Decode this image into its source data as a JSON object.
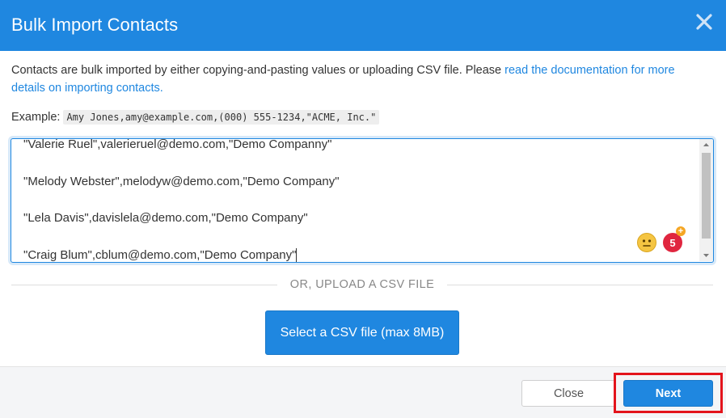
{
  "dialog": {
    "title": "Bulk Import Contacts",
    "close_icon": "close-icon"
  },
  "intro": {
    "text": "Contacts are bulk imported by either copying-and-pasting values or uploading CSV file. Please ",
    "link_text": "read the documentation for more details on importing contacts.",
    "link_color": "#1f87e0"
  },
  "example": {
    "label": "Example:",
    "code": "Amy Jones,amy@example.com,(000) 555-1234,\"ACME, Inc.\""
  },
  "textarea": {
    "lines": [
      "\"Valerie Ruel\",valerieruel@demo.com,\"Demo Companny\"",
      "\"Melody Webster\",melodyw@demo.com,\"Demo Company\"",
      "\"Lela Davis\",davislela@demo.com,\"Demo Company\"",
      "\"Craig Blum\",cblum@demo.com,\"Demo Company\""
    ],
    "emoji_icon": "neutral-face-icon",
    "grammar_badge_count": "5",
    "grammar_badge_plus": "+"
  },
  "upload": {
    "divider_label": "OR, UPLOAD A CSV FILE",
    "button_label": "Select a CSV file (max 8MB)"
  },
  "footer": {
    "close_label": "Close",
    "next_label": "Next"
  },
  "colors": {
    "accent": "#1f87e0",
    "highlight": "#e3141c",
    "grammar_badge": "#e0263f"
  }
}
